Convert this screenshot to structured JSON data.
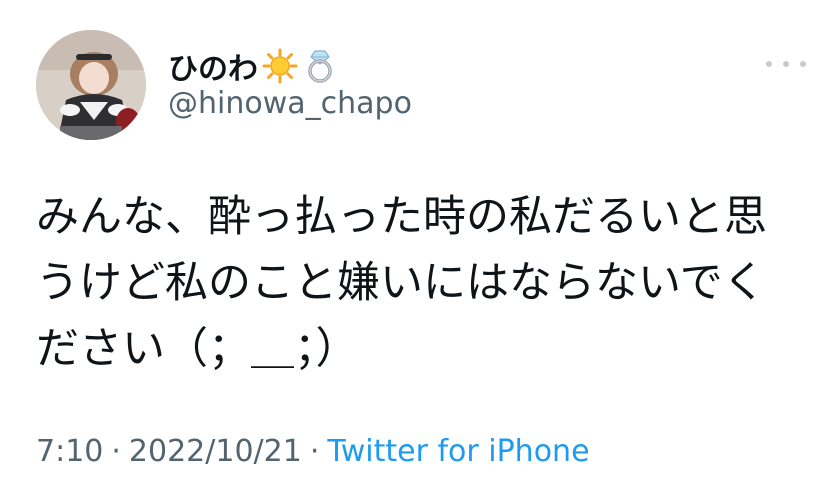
{
  "author": {
    "display_name": "ひのわ",
    "handle": "@hinowa_chapo",
    "name_emojis": [
      "sun-emoji",
      "ring-emoji"
    ]
  },
  "more_menu": {
    "icon": "more-horizontal-icon"
  },
  "tweet": {
    "lines": [
      "みんな、酔っ払った時の私だるいと思",
      "うけど私のこと嫌いにはならないでく",
      "ださい（；＿；）"
    ]
  },
  "meta": {
    "time": "7:10",
    "separator1": "·",
    "date": "2022/10/21",
    "separator2": "·",
    "source": "Twitter for iPhone"
  },
  "colors": {
    "text": "#0f1419",
    "secondary": "#536471",
    "link": "#1d9bf0"
  }
}
